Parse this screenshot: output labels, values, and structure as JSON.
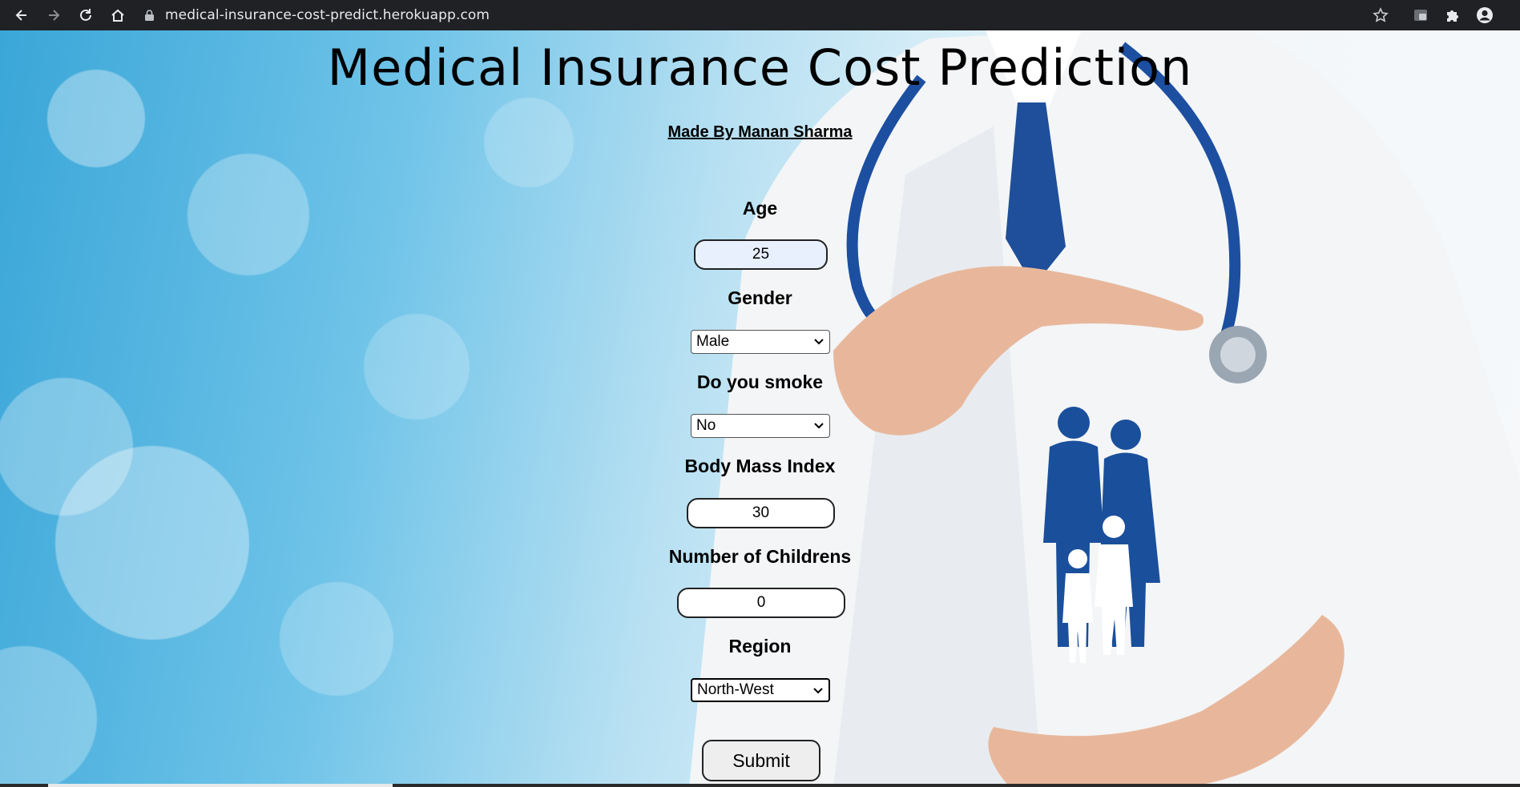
{
  "browser": {
    "url": "medical-insurance-cost-predict.herokuapp.com",
    "back_icon": "arrow-left-icon",
    "forward_icon": "arrow-right-icon",
    "reload_icon": "reload-icon",
    "home_icon": "home-icon",
    "lock_icon": "lock-icon",
    "bookmark_icon": "star-icon",
    "extension_icon": "puzzle-icon",
    "profile_icon": "profile-icon"
  },
  "page": {
    "title": "Medical Insurance Cost Prediction",
    "author": "Made By Manan Sharma"
  },
  "form": {
    "age": {
      "label": "Age",
      "value": "25"
    },
    "gender": {
      "label": "Gender",
      "value": "Male"
    },
    "smoke": {
      "label": "Do you smoke",
      "value": "No"
    },
    "bmi": {
      "label": "Body Mass Index",
      "value": "30"
    },
    "children": {
      "label": "Number of Childrens",
      "value": "0"
    },
    "region": {
      "label": "Region",
      "value": "North-West"
    },
    "submit_label": "Submit"
  },
  "colors": {
    "brand_blue": "#1a4f9c",
    "chrome_bar": "#202124"
  }
}
